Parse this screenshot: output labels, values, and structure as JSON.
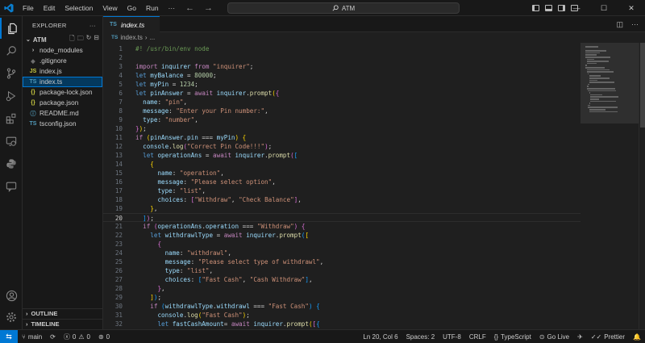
{
  "titlebar": {
    "menu": [
      "File",
      "Edit",
      "Selection",
      "View",
      "Go",
      "Run",
      "···"
    ],
    "search": "ATM",
    "back_icon": "arrow-left-icon",
    "forward_icon": "arrow-right-icon",
    "window": {
      "minimize": "—",
      "maximize": "☐",
      "close": "✕"
    }
  },
  "activitybar": [
    "explorer-icon",
    "search-icon",
    "source-control-icon",
    "run-debug-icon",
    "extensions-icon",
    "remote-explorer-icon",
    "python-icon",
    "chat-icon",
    "account-icon",
    "settings-icon"
  ],
  "sidebar": {
    "title": "EXPLORER",
    "more": "···",
    "folder": "ATM",
    "files": [
      {
        "name": "node_modules",
        "kind": "folder",
        "icon": "›",
        "color": "#cccccc"
      },
      {
        "name": ".gitignore",
        "kind": "git",
        "icon": "◆",
        "color": "#6d6d6d"
      },
      {
        "name": "index.js",
        "kind": "js",
        "icon": "JS",
        "color": "#cbcb41"
      },
      {
        "name": "index.ts",
        "kind": "ts",
        "icon": "TS",
        "color": "#519aba",
        "selected": true
      },
      {
        "name": "package-lock.json",
        "kind": "json",
        "icon": "{}",
        "color": "#cbcb41"
      },
      {
        "name": "package.json",
        "kind": "json",
        "icon": "{}",
        "color": "#cbcb41"
      },
      {
        "name": "README.md",
        "kind": "md",
        "icon": "ⓘ",
        "color": "#519aba"
      },
      {
        "name": "tsconfig.json",
        "kind": "tsconfig",
        "icon": "TS",
        "color": "#519aba"
      }
    ],
    "outline": "OUTLINE",
    "timeline": "TIMELINE"
  },
  "editor": {
    "tab": "index.ts",
    "tab_icon": "TS",
    "breadcrumb_file": "index.ts",
    "breadcrumb_more": "...",
    "current_line": 20,
    "lines": [
      {
        "n": "1",
        "t": [
          [
            "c",
            "#! /usr/bin/env node"
          ]
        ]
      },
      {
        "n": "2",
        "t": []
      },
      {
        "n": "3",
        "t": [
          [
            "k",
            "import"
          ],
          [
            "p",
            " "
          ],
          [
            "v",
            "inquirer"
          ],
          [
            "p",
            " "
          ],
          [
            "k",
            "from"
          ],
          [
            "p",
            " "
          ],
          [
            "s",
            "\"inquirer\""
          ],
          [
            "p",
            ";"
          ]
        ]
      },
      {
        "n": "4",
        "t": [
          [
            "d",
            "let"
          ],
          [
            "p",
            " "
          ],
          [
            "v",
            "myBalance"
          ],
          [
            "p",
            " = "
          ],
          [
            "n",
            "80000"
          ],
          [
            "p",
            ";"
          ]
        ]
      },
      {
        "n": "5",
        "t": [
          [
            "d",
            "let"
          ],
          [
            "p",
            " "
          ],
          [
            "v",
            "myPin"
          ],
          [
            "p",
            " = "
          ],
          [
            "n",
            "1234"
          ],
          [
            "p",
            ";"
          ]
        ]
      },
      {
        "n": "6",
        "t": [
          [
            "d",
            "let"
          ],
          [
            "p",
            " "
          ],
          [
            "v",
            "pinAnswer"
          ],
          [
            "p",
            " = "
          ],
          [
            "k",
            "await"
          ],
          [
            "p",
            " "
          ],
          [
            "v",
            "inquirer"
          ],
          [
            "p",
            "."
          ],
          [
            "f",
            "prompt"
          ],
          [
            "b1",
            "("
          ],
          [
            "b2",
            "{"
          ]
        ]
      },
      {
        "n": "7",
        "t": [
          [
            "p",
            "  "
          ],
          [
            "v",
            "name"
          ],
          [
            "p",
            ": "
          ],
          [
            "s",
            "\"pin\""
          ],
          [
            "p",
            ","
          ]
        ]
      },
      {
        "n": "8",
        "t": [
          [
            "p",
            "  "
          ],
          [
            "v",
            "message"
          ],
          [
            "p",
            ": "
          ],
          [
            "s",
            "\"Enter your Pin number:\""
          ],
          [
            "p",
            ","
          ]
        ]
      },
      {
        "n": "9",
        "t": [
          [
            "p",
            "  "
          ],
          [
            "v",
            "type"
          ],
          [
            "p",
            ": "
          ],
          [
            "s",
            "\"number\""
          ],
          [
            "p",
            ","
          ]
        ]
      },
      {
        "n": "10",
        "t": [
          [
            "b2",
            "}"
          ],
          [
            "b1",
            ")"
          ],
          [
            "p",
            ";"
          ]
        ]
      },
      {
        "n": "11",
        "t": [
          [
            "k",
            "if"
          ],
          [
            "p",
            " "
          ],
          [
            "b1",
            "("
          ],
          [
            "v",
            "pinAnswer"
          ],
          [
            "p",
            "."
          ],
          [
            "v",
            "pin"
          ],
          [
            "p",
            " === "
          ],
          [
            "v",
            "myPin"
          ],
          [
            "b1",
            ")"
          ],
          [
            "p",
            " "
          ],
          [
            "b1",
            "{"
          ]
        ]
      },
      {
        "n": "12",
        "t": [
          [
            "p",
            "  "
          ],
          [
            "v",
            "console"
          ],
          [
            "p",
            "."
          ],
          [
            "f",
            "log"
          ],
          [
            "b2",
            "("
          ],
          [
            "s",
            "\"Correct Pin Code!!!\""
          ],
          [
            "b2",
            ")"
          ],
          [
            "p",
            ";"
          ]
        ]
      },
      {
        "n": "13",
        "t": [
          [
            "p",
            "  "
          ],
          [
            "d",
            "let"
          ],
          [
            "p",
            " "
          ],
          [
            "v",
            "operationAns"
          ],
          [
            "p",
            " = "
          ],
          [
            "k",
            "await"
          ],
          [
            "p",
            " "
          ],
          [
            "v",
            "inquirer"
          ],
          [
            "p",
            "."
          ],
          [
            "f",
            "prompt"
          ],
          [
            "b2",
            "("
          ],
          [
            "b3",
            "["
          ]
        ]
      },
      {
        "n": "14",
        "t": [
          [
            "p",
            "    "
          ],
          [
            "b1",
            "{"
          ]
        ]
      },
      {
        "n": "15",
        "t": [
          [
            "p",
            "      "
          ],
          [
            "v",
            "name"
          ],
          [
            "p",
            ": "
          ],
          [
            "s",
            "\"operation\""
          ],
          [
            "p",
            ","
          ]
        ]
      },
      {
        "n": "16",
        "t": [
          [
            "p",
            "      "
          ],
          [
            "v",
            "message"
          ],
          [
            "p",
            ": "
          ],
          [
            "s",
            "\"Please select option\""
          ],
          [
            "p",
            ","
          ]
        ]
      },
      {
        "n": "17",
        "t": [
          [
            "p",
            "      "
          ],
          [
            "v",
            "type"
          ],
          [
            "p",
            ": "
          ],
          [
            "s",
            "\"list\""
          ],
          [
            "p",
            ","
          ]
        ]
      },
      {
        "n": "18",
        "t": [
          [
            "p",
            "      "
          ],
          [
            "v",
            "choices"
          ],
          [
            "p",
            ": "
          ],
          [
            "b2",
            "["
          ],
          [
            "s",
            "\"Withdraw\""
          ],
          [
            "p",
            ", "
          ],
          [
            "s",
            "\"Check Balance\""
          ],
          [
            "b2",
            "]"
          ],
          [
            "p",
            ","
          ]
        ]
      },
      {
        "n": "19",
        "t": [
          [
            "p",
            "    "
          ],
          [
            "b1",
            "}"
          ],
          [
            "p",
            ","
          ]
        ]
      },
      {
        "n": "20",
        "t": [
          [
            "p",
            "  "
          ],
          [
            "b3",
            "]"
          ],
          [
            "b2",
            ")"
          ],
          [
            "p",
            ";"
          ]
        ]
      },
      {
        "n": "21",
        "t": [
          [
            "p",
            "  "
          ],
          [
            "k",
            "if"
          ],
          [
            "p",
            " "
          ],
          [
            "b2",
            "("
          ],
          [
            "v",
            "operationAns"
          ],
          [
            "p",
            "."
          ],
          [
            "v",
            "operation"
          ],
          [
            "p",
            " === "
          ],
          [
            "s",
            "\"Withdraw\""
          ],
          [
            "b2",
            ")"
          ],
          [
            "p",
            " "
          ],
          [
            "b2",
            "{"
          ]
        ]
      },
      {
        "n": "22",
        "t": [
          [
            "p",
            "    "
          ],
          [
            "d",
            "let"
          ],
          [
            "p",
            " "
          ],
          [
            "v",
            "withdrawlType"
          ],
          [
            "p",
            " = "
          ],
          [
            "k",
            "await"
          ],
          [
            "p",
            " "
          ],
          [
            "v",
            "inquirer"
          ],
          [
            "p",
            "."
          ],
          [
            "f",
            "prompt"
          ],
          [
            "b3",
            "("
          ],
          [
            "b1",
            "["
          ]
        ]
      },
      {
        "n": "23",
        "t": [
          [
            "p",
            "      "
          ],
          [
            "b2",
            "{"
          ]
        ]
      },
      {
        "n": "24",
        "t": [
          [
            "p",
            "        "
          ],
          [
            "v",
            "name"
          ],
          [
            "p",
            ": "
          ],
          [
            "s",
            "\"withdrawl\""
          ],
          [
            "p",
            ","
          ]
        ]
      },
      {
        "n": "25",
        "t": [
          [
            "p",
            "        "
          ],
          [
            "v",
            "message"
          ],
          [
            "p",
            ": "
          ],
          [
            "s",
            "\"Please select type of withdrawl\""
          ],
          [
            "p",
            ","
          ]
        ]
      },
      {
        "n": "26",
        "t": [
          [
            "p",
            "        "
          ],
          [
            "v",
            "type"
          ],
          [
            "p",
            ": "
          ],
          [
            "s",
            "\"list\""
          ],
          [
            "p",
            ","
          ]
        ]
      },
      {
        "n": "27",
        "t": [
          [
            "p",
            "        "
          ],
          [
            "v",
            "choices"
          ],
          [
            "p",
            ": "
          ],
          [
            "b3",
            "["
          ],
          [
            "s",
            "\"Fast Cash\""
          ],
          [
            "p",
            ", "
          ],
          [
            "s",
            "\"Cash Withdraw\""
          ],
          [
            "b3",
            "]"
          ],
          [
            "p",
            ","
          ]
        ]
      },
      {
        "n": "28",
        "t": [
          [
            "p",
            "      "
          ],
          [
            "b2",
            "}"
          ],
          [
            "p",
            ","
          ]
        ]
      },
      {
        "n": "29",
        "t": [
          [
            "p",
            "    "
          ],
          [
            "b1",
            "]"
          ],
          [
            "b3",
            ")"
          ],
          [
            "p",
            ";"
          ]
        ]
      },
      {
        "n": "30",
        "t": [
          [
            "p",
            "    "
          ],
          [
            "k",
            "if"
          ],
          [
            "p",
            " "
          ],
          [
            "b3",
            "("
          ],
          [
            "v",
            "withdrawlType"
          ],
          [
            "p",
            "."
          ],
          [
            "v",
            "withdrawl"
          ],
          [
            "p",
            " === "
          ],
          [
            "s",
            "\"Fast Cash\""
          ],
          [
            "b3",
            ")"
          ],
          [
            "p",
            " "
          ],
          [
            "b3",
            "{"
          ]
        ]
      },
      {
        "n": "31",
        "t": [
          [
            "p",
            "      "
          ],
          [
            "v",
            "console"
          ],
          [
            "p",
            "."
          ],
          [
            "f",
            "log"
          ],
          [
            "b1",
            "("
          ],
          [
            "s",
            "\"Fast Cash\""
          ],
          [
            "b1",
            ")"
          ],
          [
            "p",
            ";"
          ]
        ]
      },
      {
        "n": "32",
        "t": [
          [
            "p",
            "      "
          ],
          [
            "d",
            "let"
          ],
          [
            "p",
            " "
          ],
          [
            "v",
            "fastCashAmount"
          ],
          [
            "p",
            "= "
          ],
          [
            "k",
            "await"
          ],
          [
            "p",
            " "
          ],
          [
            "v",
            "inquirer"
          ],
          [
            "p",
            "."
          ],
          [
            "f",
            "prompt"
          ],
          [
            "b1",
            "("
          ],
          [
            "b2",
            "["
          ],
          [
            "b3",
            "{"
          ]
        ]
      }
    ]
  },
  "statusbar": {
    "branch": "main",
    "sync_icon": "sync-icon",
    "errors": "0",
    "warnings": "0",
    "ports": "0",
    "position": "Ln 20, Col 6",
    "spaces": "Spaces: 2",
    "encoding": "UTF-8",
    "eol": "CRLF",
    "language": "TypeScript",
    "golive": "Go Live",
    "prettier": "Prettier"
  },
  "colors": {
    "accent": "#0078d4",
    "background": "#1f1f1f",
    "chrome": "#181818"
  }
}
